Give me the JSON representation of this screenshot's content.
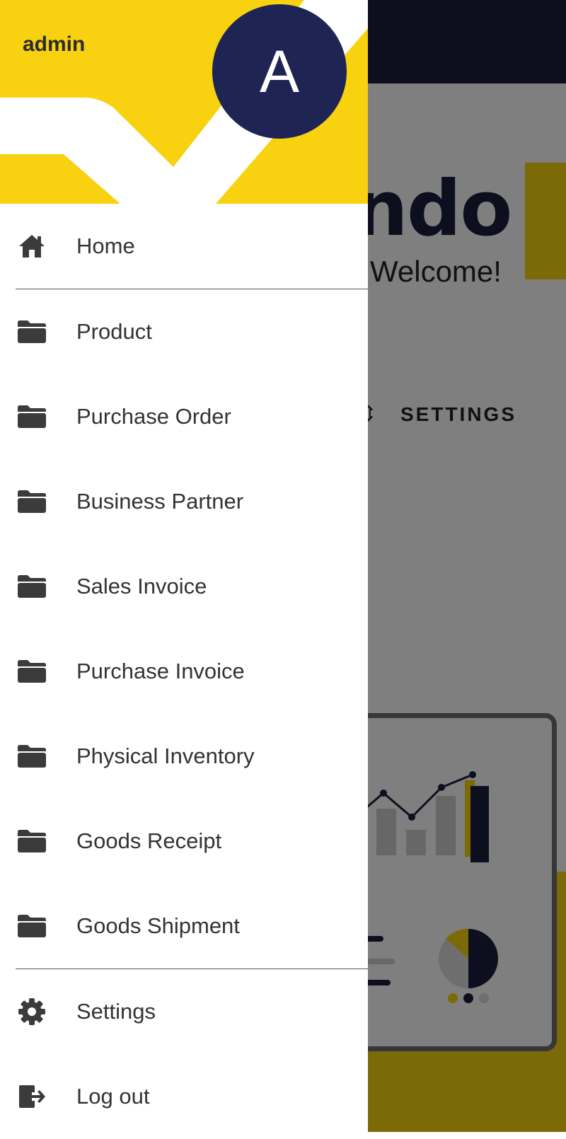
{
  "background": {
    "brand_fragment": "ndo",
    "welcome": "Welcome!",
    "settings_tab": "SETTINGS",
    "topbar_color": "#1b1f3f",
    "accent_color": "#f8d210"
  },
  "drawer": {
    "username": "admin",
    "avatar_initial": "A",
    "header_color": "#f8d210",
    "avatar_color": "#1e2454",
    "items": [
      {
        "label": "Home",
        "icon": "home-icon"
      },
      {
        "label": "Product",
        "icon": "folder-icon"
      },
      {
        "label": "Purchase Order",
        "icon": "folder-icon"
      },
      {
        "label": "Business Partner",
        "icon": "folder-icon"
      },
      {
        "label": "Sales Invoice",
        "icon": "folder-icon"
      },
      {
        "label": "Purchase Invoice",
        "icon": "folder-icon"
      },
      {
        "label": "Physical Inventory",
        "icon": "folder-icon"
      },
      {
        "label": "Goods Receipt",
        "icon": "folder-icon"
      },
      {
        "label": "Goods Shipment",
        "icon": "folder-icon"
      },
      {
        "label": "Settings",
        "icon": "gear-icon"
      },
      {
        "label": "Log out",
        "icon": "logout-icon"
      }
    ]
  }
}
